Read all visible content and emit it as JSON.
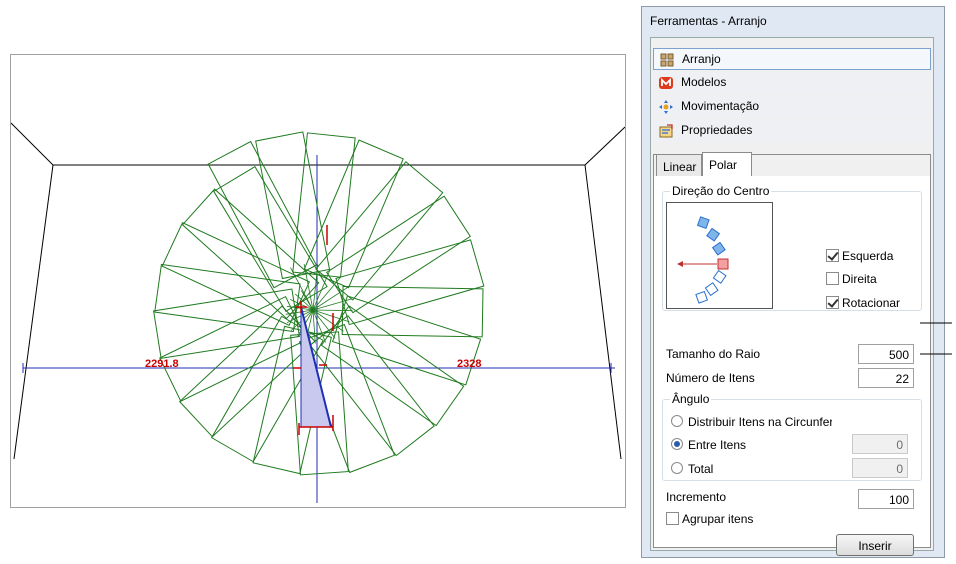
{
  "viewport": {
    "dimension_left": "2291.8",
    "dimension_right": "2328"
  },
  "panel": {
    "title": "Ferramentas - Arranjo",
    "categories": [
      {
        "label": "Arranjo",
        "icon": "arranjo-icon",
        "selected": true
      },
      {
        "label": "Modelos",
        "icon": "modelos-icon",
        "selected": false
      },
      {
        "label": "Movimentação",
        "icon": "movimentacao-icon",
        "selected": false
      },
      {
        "label": "Propriedades",
        "icon": "propriedades-icon",
        "selected": false
      }
    ],
    "tabs": [
      {
        "label": "Linear",
        "active": false
      },
      {
        "label": "Polar",
        "active": true
      }
    ],
    "direction_group": {
      "legend": "Direção do Centro",
      "esquerda": {
        "label": "Esquerda",
        "checked": true
      },
      "direita": {
        "label": "Direita",
        "checked": false
      },
      "rotacionar": {
        "label": "Rotacionar",
        "checked": true
      }
    },
    "raio": {
      "label": "Tamanho do Raio",
      "value": "500"
    },
    "itens": {
      "label": "Número de Itens",
      "value": "22"
    },
    "angulo_group": {
      "legend": "Ângulo",
      "distribuir": {
        "label": "Distribuir Itens na Circunferênc",
        "checked": false
      },
      "entre": {
        "label": "Entre Itens",
        "checked": true,
        "value": "0"
      },
      "total": {
        "label": "Total",
        "checked": false,
        "value": "0"
      }
    },
    "incremento": {
      "label": "Incremento",
      "value": "100"
    },
    "agrupar": {
      "label": "Agrupar itens",
      "checked": false
    },
    "inserir_label": "Inserir"
  },
  "colors": {
    "rect_stroke": "#1f7a1f",
    "axis": "#1f2fb5",
    "dim_text": "#cc0000"
  }
}
